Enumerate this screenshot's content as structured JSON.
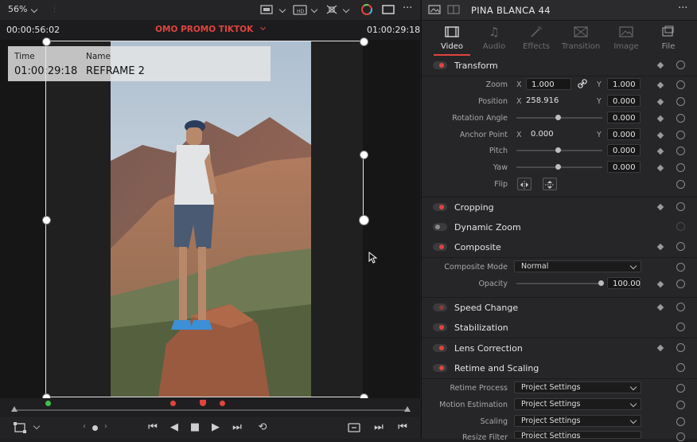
{
  "viewer": {
    "zoom_label": "56%",
    "timecode_left": "00:00:56:02",
    "timeline_name": "OMO PROMO TIKTOK",
    "timecode_right": "01:00:29:18",
    "info": {
      "time_label": "Time",
      "time_value": "01:00:29:18",
      "name_label": "Name",
      "name_value": "REFRAME 2"
    }
  },
  "inspector": {
    "clip_name": "PINA BLANCA 44",
    "tabs": [
      {
        "label": "Video",
        "icon": "film-icon",
        "active": true
      },
      {
        "label": "Audio",
        "icon": "music-icon",
        "active": false
      },
      {
        "label": "Effects",
        "icon": "wand-icon",
        "active": false
      },
      {
        "label": "Transition",
        "icon": "transition-icon",
        "active": false
      },
      {
        "label": "Image",
        "icon": "image-icon",
        "active": false
      },
      {
        "label": "File",
        "icon": "file-icon",
        "active": false
      }
    ],
    "transform": {
      "title": "Transform",
      "zoom_label": "Zoom",
      "zoom_x": "1.000",
      "zoom_y": "1.000",
      "position_label": "Position",
      "position_x": "258.916",
      "position_y": "0.000",
      "rotation_label": "Rotation Angle",
      "rotation_value": "0.000",
      "anchor_label": "Anchor Point",
      "anchor_x": "0.000",
      "anchor_y": "0.000",
      "pitch_label": "Pitch",
      "pitch_value": "0.000",
      "yaw_label": "Yaw",
      "yaw_value": "0.000",
      "flip_label": "Flip",
      "x_axis": "X",
      "y_axis": "Y"
    },
    "sections": {
      "cropping": "Cropping",
      "dynamic_zoom": "Dynamic Zoom",
      "composite": "Composite",
      "speed_change": "Speed Change",
      "stabilization": "Stabilization",
      "lens_correction": "Lens Correction",
      "retime": "Retime and Scaling"
    },
    "composite": {
      "mode_label": "Composite Mode",
      "mode_value": "Normal",
      "opacity_label": "Opacity",
      "opacity_value": "100.00"
    },
    "retime": {
      "process_label": "Retime Process",
      "process_value": "Project Settings",
      "motion_label": "Motion Estimation",
      "motion_value": "Project Settings",
      "scaling_label": "Scaling",
      "scaling_value": "Project Settings",
      "resize_label": "Resize Filter",
      "resize_value": "Project Settings"
    }
  },
  "colors": {
    "accent_red": "#e2443d",
    "timeline_red": "#e0443e",
    "panel_bg": "#262628",
    "field_bg": "#171718"
  }
}
